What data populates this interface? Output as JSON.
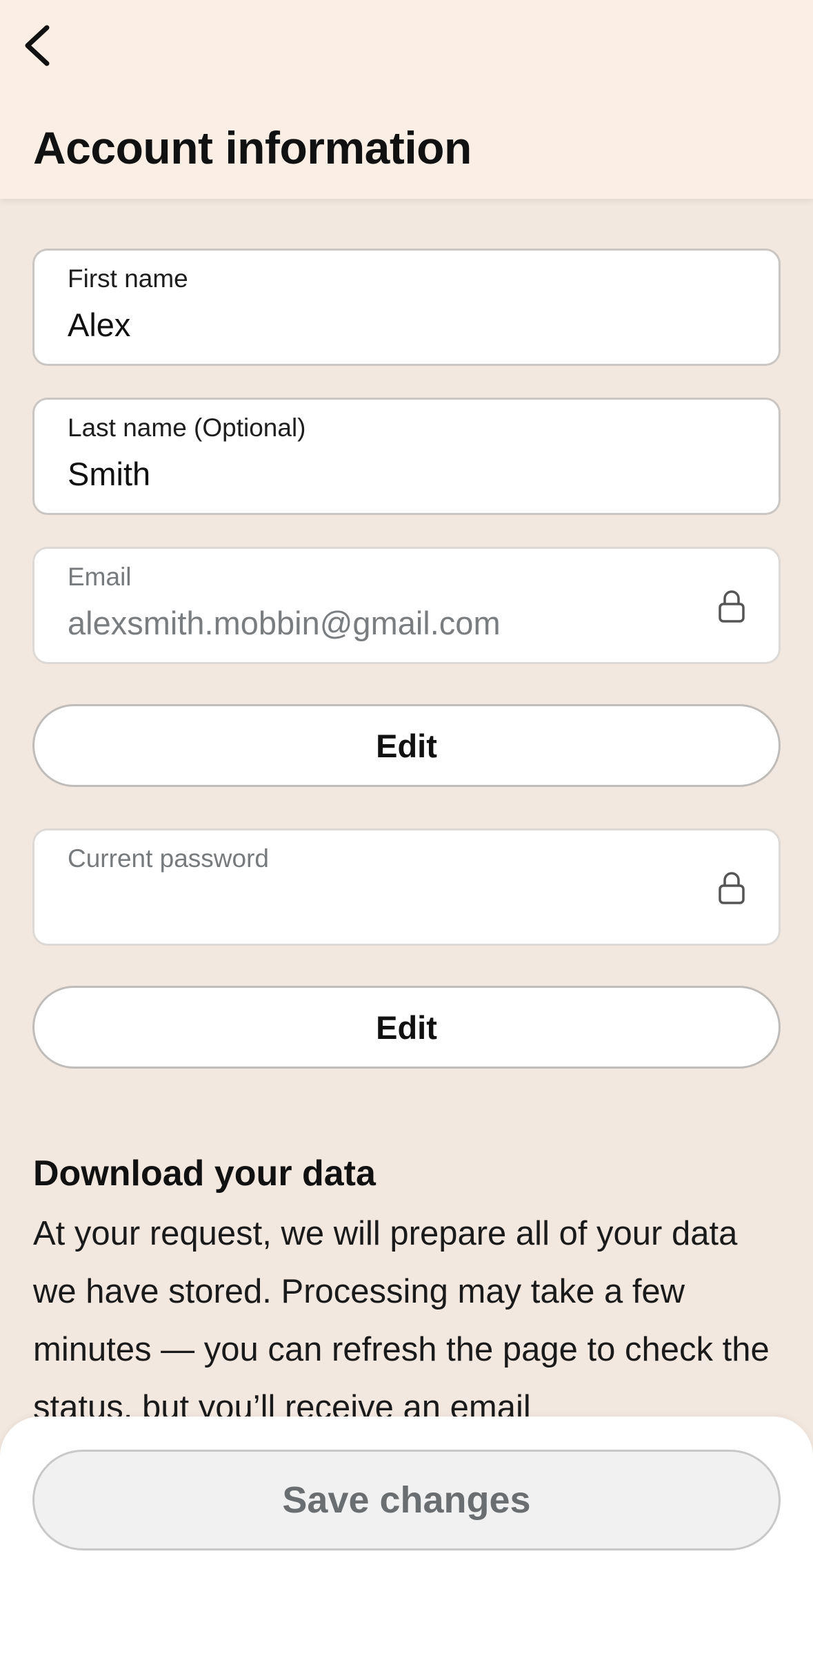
{
  "header": {
    "back_icon": "chevron-left-icon",
    "title": "Account information"
  },
  "fields": {
    "first_name": {
      "label": "First name",
      "value": "Alex"
    },
    "last_name": {
      "label": "Last name (Optional)",
      "value": "Smith"
    },
    "email": {
      "label": "Email",
      "value": "alexsmith.mobbin@gmail.com",
      "icon": "lock-icon"
    },
    "password": {
      "label": "Current password",
      "value": "",
      "icon": "lock-icon"
    }
  },
  "buttons": {
    "edit_email": "Edit",
    "edit_password": "Edit",
    "save": "Save changes"
  },
  "download": {
    "heading": "Download your data",
    "body": "At your request, we will prepare all of your data we have stored. Processing may take a few minutes — you can refresh the page to check the status, but you’ll receive an email"
  },
  "colors": {
    "background": "#f3e8e0",
    "header_background": "#fbefe5",
    "save_disabled_text": "#6a6e71"
  }
}
